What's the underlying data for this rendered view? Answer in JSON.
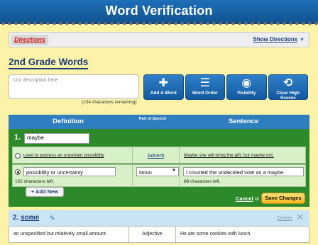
{
  "app": {
    "title": "Word Verification"
  },
  "directions": {
    "tab_label": "Directions",
    "show_label": "Show Directions"
  },
  "list": {
    "title": "2nd Grade Words",
    "description_placeholder": "List description here",
    "chars_remaining": "(234 characters remaining)"
  },
  "toolbar": {
    "add_word": "Add A Word",
    "word_order": "Word Order",
    "visibility": "Visibility",
    "clear_high_scores": "Clear High Scores"
  },
  "table_headers": {
    "definition": "Definition",
    "part_of_speech": "Part of Speech",
    "sentence": "Sentence"
  },
  "words": [
    {
      "number": "1.",
      "word": "maybe",
      "senses": [
        {
          "definition": "used to express an uncertain possibility",
          "part_of_speech": "Adverb",
          "sentence": "Maybe she will bring the gift, but maybe not.",
          "selected": false
        },
        {
          "definition": "possibility or uncertainty",
          "definition_chars_left": "102 characters left.",
          "part_of_speech": "Noun",
          "sentence": "I counted the undecided vote as a maybe.",
          "sentence_chars_left": "88 characters left.",
          "selected": true
        }
      ],
      "add_new_label": "+ Add New",
      "cancel_label": "Cancel",
      "or_label": "or",
      "save_label": "Save Changes"
    },
    {
      "number": "2.",
      "word": "some",
      "delete_label": "Delete",
      "senses": [
        {
          "definition": "an unspecified but relatively small amount",
          "part_of_speech": "Adjective",
          "sentence": "He ate some cookies with lunch."
        }
      ]
    }
  ],
  "colors": {
    "header_blue": "#2f7fc0",
    "word_green": "#2d8a2a",
    "sense_bg": "#d7f0c8",
    "page_bg": "#fdf3a8",
    "save_yellow": "#f5b81d"
  },
  "icons": [
    "plus-icon",
    "list-order-icon",
    "eye-icon",
    "refresh-trophy-icon",
    "pencil-icon",
    "close-icon",
    "chevron-down-icon"
  ]
}
